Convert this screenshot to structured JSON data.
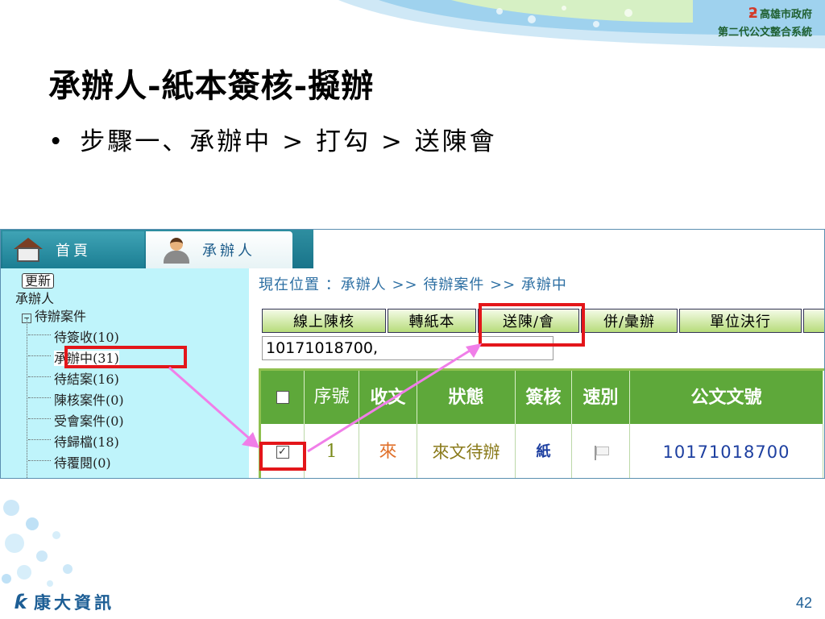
{
  "header_logo": {
    "line1": "高雄市政府",
    "line2": "第二代公文整合系統"
  },
  "slide": {
    "title": "承辦人-紙本簽核-擬辦",
    "bullet": "步驟一、承辦中 > 打勾 > 送陳會"
  },
  "tabs": [
    {
      "label": "首頁",
      "icon": "home-icon"
    },
    {
      "label": "承辦人",
      "icon": "officer-icon"
    }
  ],
  "sidebar": {
    "refresh_label": "更新",
    "root_label": "承辦人",
    "folder_label": "待辦案件",
    "items": [
      {
        "label": "待簽收(10)"
      },
      {
        "label": "承辦中(31)"
      },
      {
        "label": "待結案(16)"
      },
      {
        "label": "陳核案件(0)"
      },
      {
        "label": "受會案件(0)"
      },
      {
        "label": "待歸檔(18)"
      },
      {
        "label": "待覆閱(0)"
      }
    ]
  },
  "main": {
    "breadcrumb": "現在位置 ：承辦人 >> 待辦案件 >> 承辦中",
    "toolbar": {
      "buttons": [
        {
          "label": "線上陳核"
        },
        {
          "label": "轉紙本"
        },
        {
          "label": "送陳/會"
        },
        {
          "label": "併/彙辦"
        },
        {
          "label": "單位決行"
        }
      ]
    },
    "doc_number_value": "10171018700,",
    "grid": {
      "headers": [
        "序號",
        "收文",
        "狀態",
        "簽核",
        "速別",
        "公文文號"
      ],
      "rows": [
        {
          "seq": "1",
          "recv": "來",
          "status": "來文待辦",
          "sign": "紙",
          "speed": "flag-icon",
          "doc_no": "10171018700"
        }
      ]
    }
  },
  "footer": {
    "brand": "康大資訊",
    "page_number": "42"
  },
  "colors": {
    "highlight": "#e3161a",
    "arrow": "#f07ee8",
    "grid_header": "#5ea83a",
    "sidebar_bg": "#bff4fb"
  }
}
